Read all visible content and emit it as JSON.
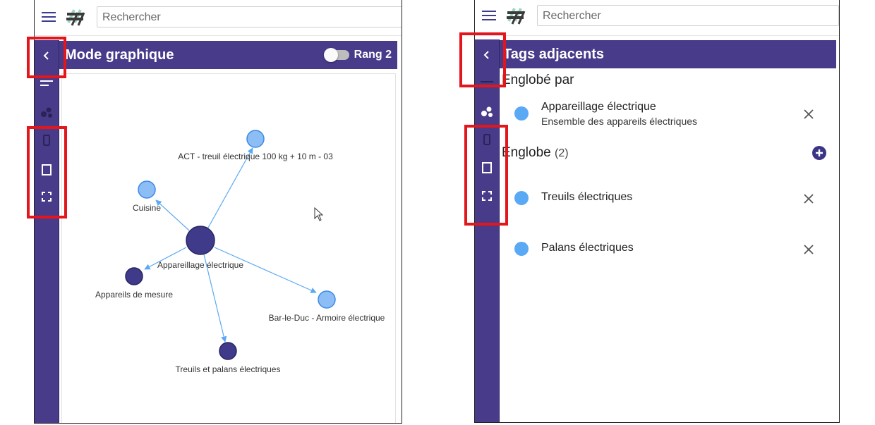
{
  "left_panel": {
    "search_placeholder": "Rechercher",
    "header_title": "Mode graphique",
    "rank_label": "Rang 2",
    "graph": {
      "center": "Appareillage électrique",
      "nodes": [
        {
          "label": "ACT - treuil électrique 100 kg + 10 m - 03",
          "kind": "light"
        },
        {
          "label": "Cuisine",
          "kind": "light"
        },
        {
          "label": "Appareils de mesure",
          "kind": "dark"
        },
        {
          "label": "Bar-le-Duc - Armoire électrique",
          "kind": "light"
        },
        {
          "label": "Treuils et palans électriques",
          "kind": "dark"
        }
      ]
    }
  },
  "right_panel": {
    "search_placeholder": "Rechercher",
    "header_title": "Tags adjacents",
    "englobe_par": {
      "title": "Englobé par",
      "items": [
        {
          "name": "Appareillage électrique",
          "desc": "Ensemble des appareils électriques"
        }
      ]
    },
    "englobe": {
      "title": "Englobe",
      "count": "(2)",
      "items": [
        {
          "name": "Treuils électriques"
        },
        {
          "name": "Palans électriques"
        }
      ]
    }
  },
  "colors": {
    "brand_purple": "#473b8a",
    "node_dark": "#3f3a8a",
    "node_light": "#8dbdf5",
    "edge": "#5aa9f5",
    "highlight_red": "#e3161c"
  }
}
